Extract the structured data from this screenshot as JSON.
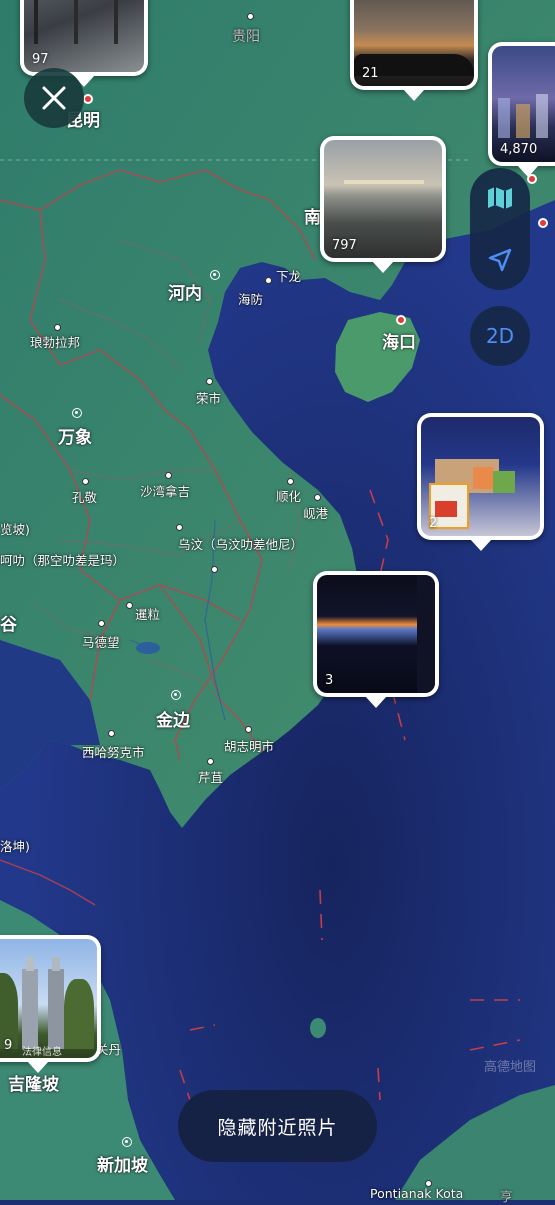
{
  "map": {
    "labels": {
      "guiyang": "贵阳",
      "kunming": "昆明",
      "nan": "南",
      "hanoi": "河内",
      "xialong": "下龙",
      "haiphong": "海防",
      "haikou": "海口",
      "luang_prabang": "琅勃拉邦",
      "vinh": "荣市",
      "vientiane": "万象",
      "thakhek": "孔敬",
      "savannakhet": "沙湾拿吉",
      "hue": "顺化",
      "danang": "岘港",
      "ubon": "乌汶（乌汶叻差他尼）",
      "nakhon_ratchasima": "呵叻（那空叻差是玛）",
      "left_cut_1": "览坡)",
      "stung_treng": "暹粒",
      "battambang": "马德望",
      "phnom_penh": "金边",
      "sihanoukville": "西哈努克市",
      "hcmc": "胡志明市",
      "can_tho": "芹苴",
      "left_cut_2": "谷",
      "left_cut_3": "洛坤)",
      "kuantan": "关丹",
      "kuala_lumpur": "吉隆坡",
      "singapore": "新加坡",
      "pontianak": "Pontianak Kota",
      "right_cut": "亨",
      "small_label": "法律信息"
    },
    "watermark": "高德地图",
    "colors": {
      "water": "#1c2f72",
      "land": "#3d8a74",
      "border": "#c0414f"
    }
  },
  "photos": [
    {
      "id": "p1",
      "count": "97"
    },
    {
      "id": "p2",
      "count": "21"
    },
    {
      "id": "p3",
      "count": "4,870"
    },
    {
      "id": "p4",
      "count": "797"
    },
    {
      "id": "p5",
      "count": "2"
    },
    {
      "id": "p6",
      "count": "3"
    },
    {
      "id": "p7",
      "count": "9"
    }
  ],
  "controls": {
    "close_icon": "close-icon",
    "map_icon": "map-icon",
    "locate_icon": "location-arrow-icon",
    "view_mode": "2D",
    "hide_nearby": "隐藏附近照片"
  }
}
